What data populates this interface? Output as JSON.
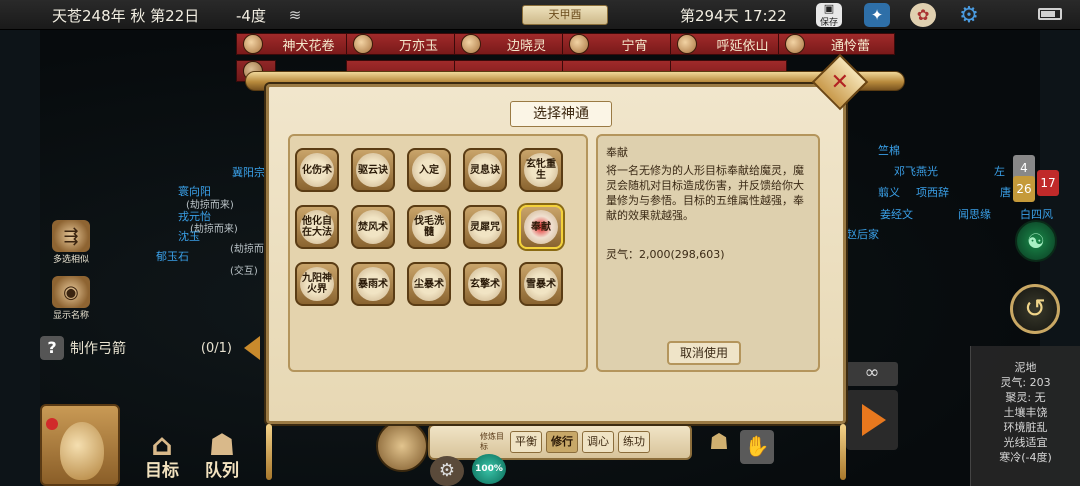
{
  "topbar": {
    "date": "天苍248年 秋 第22日",
    "temperature": "-4度",
    "title": "天甲酉",
    "day_time": "第294天 17:22",
    "save_label": "保存"
  },
  "tags_row1": [
    {
      "name": "神犬花卷"
    },
    {
      "name": "万亦玉"
    },
    {
      "name": "边晓灵"
    },
    {
      "name": "宁宵"
    },
    {
      "name": "呼延依山"
    },
    {
      "name": "通怜蕾"
    }
  ],
  "map_labels": [
    {
      "text": "冀阳宗"
    },
    {
      "text": "寰向阳"
    },
    {
      "text": "(劫掠而来)"
    },
    {
      "text": "戎元怡"
    },
    {
      "text": "(劫掠而来)"
    },
    {
      "text": "沈玉"
    },
    {
      "text": "(劫掠而来)"
    },
    {
      "text": "(交互)"
    },
    {
      "text": "郁玉石"
    },
    {
      "text": "竺棉"
    },
    {
      "text": "邓飞燕光"
    },
    {
      "text": "翦义"
    },
    {
      "text": "项西辞"
    },
    {
      "text": "姜经文"
    },
    {
      "text": "闻思缘"
    },
    {
      "text": "白四风"
    },
    {
      "text": "左"
    },
    {
      "text": "唐"
    },
    {
      "text": "赵后家"
    }
  ],
  "left_controls": {
    "multi_select": "多选相似",
    "show_names": "显示名称",
    "craft_help": "?",
    "craft_label": "制作弓箭",
    "craft_count": "(0/1)"
  },
  "bottom_actions": {
    "target": "目标",
    "queue": "队列"
  },
  "dialog": {
    "title": "选择神通",
    "close": "✕",
    "skills": [
      {
        "label": "化伤术"
      },
      {
        "label": "驱云诀"
      },
      {
        "label": "入定"
      },
      {
        "label": "灵息诀"
      },
      {
        "label": "玄牝重生"
      },
      {
        "label": "他化自在大法"
      },
      {
        "label": "焚风术"
      },
      {
        "label": "伐毛洗髓"
      },
      {
        "label": "灵犀咒"
      },
      {
        "label": "奉献"
      },
      {
        "label": "九阳神火界"
      },
      {
        "label": "暴雨术"
      },
      {
        "label": "尘暴术"
      },
      {
        "label": "玄擎术"
      },
      {
        "label": "雪暴术"
      }
    ],
    "selected_index": 9,
    "detail": {
      "name": "奉献",
      "description": "将一名无修为的人形目标奉献给魔灵，魔灵会随机对目标造成伤害，并反馈给你大量修为与参悟。目标的五维属性越强，奉献的效果就越强。",
      "cost": "灵气：2,000(298,603)"
    },
    "cancel_label": "取消使用"
  },
  "bottom_bar": {
    "mode_label": "修炼目标",
    "modes": [
      {
        "label": "平衡"
      },
      {
        "label": "修行"
      },
      {
        "label": "调心"
      },
      {
        "label": "练功"
      }
    ],
    "active_mode": "修行",
    "percent": "100%"
  },
  "right_side": {
    "num_gray": "4",
    "num_gold": "26",
    "num_red": "17",
    "infinity": "∞"
  },
  "info_panel": {
    "terrain": "泥地",
    "qi": "灵气: 203",
    "gather": "聚灵: 无",
    "soil": "土壤丰饶",
    "env": "环境脏乱",
    "light": "光线适宜",
    "cold": "寒冷(-4度)"
  },
  "colors": {
    "tag_red": "#8a1f1f",
    "accent_gold": "#c9a864",
    "map_blue": "#3aa0e8"
  }
}
